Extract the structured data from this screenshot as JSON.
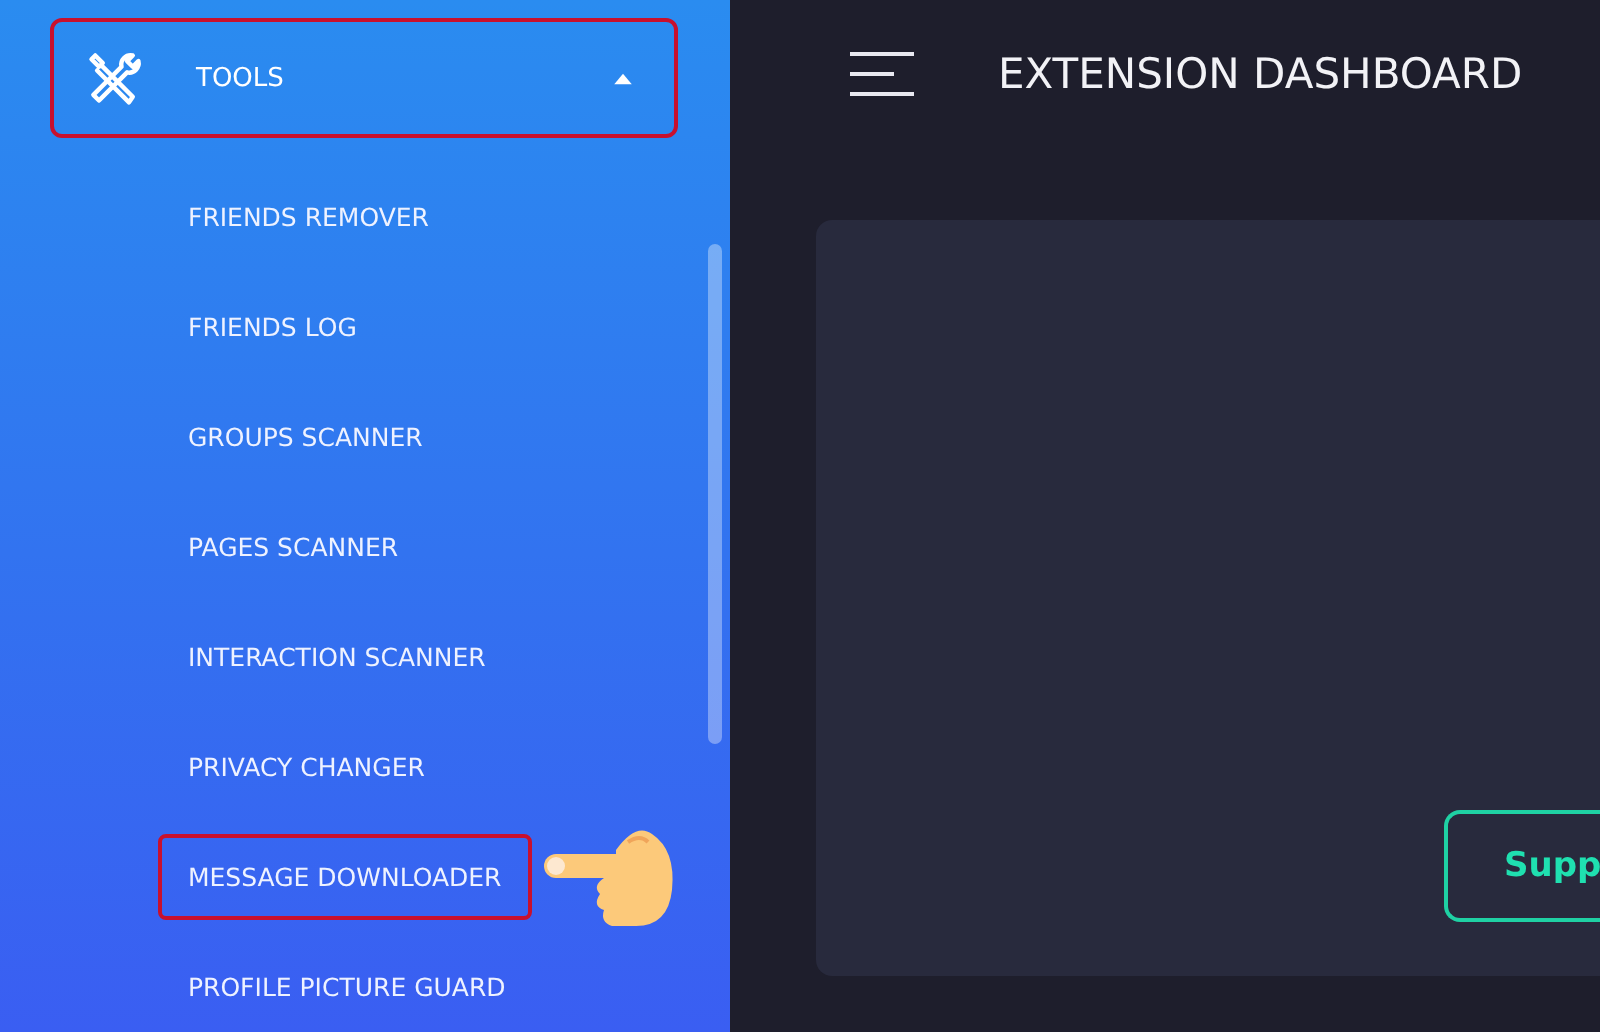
{
  "sidebar": {
    "section": {
      "label": "TOOLS",
      "expanded": true,
      "highlighted": true
    },
    "items": [
      {
        "label": "FRIENDS REMOVER",
        "highlighted": false
      },
      {
        "label": "FRIENDS LOG",
        "highlighted": false
      },
      {
        "label": "GROUPS SCANNER",
        "highlighted": false
      },
      {
        "label": "PAGES SCANNER",
        "highlighted": false
      },
      {
        "label": "INTERACTION SCANNER",
        "highlighted": false
      },
      {
        "label": "PRIVACY CHANGER",
        "highlighted": false
      },
      {
        "label": "MESSAGE DOWNLOADER",
        "highlighted": true
      },
      {
        "label": "PROFILE PICTURE GUARD",
        "highlighted": false
      }
    ]
  },
  "header": {
    "title": "EXTENSION DASHBOARD"
  },
  "card": {
    "button": "Supp"
  }
}
